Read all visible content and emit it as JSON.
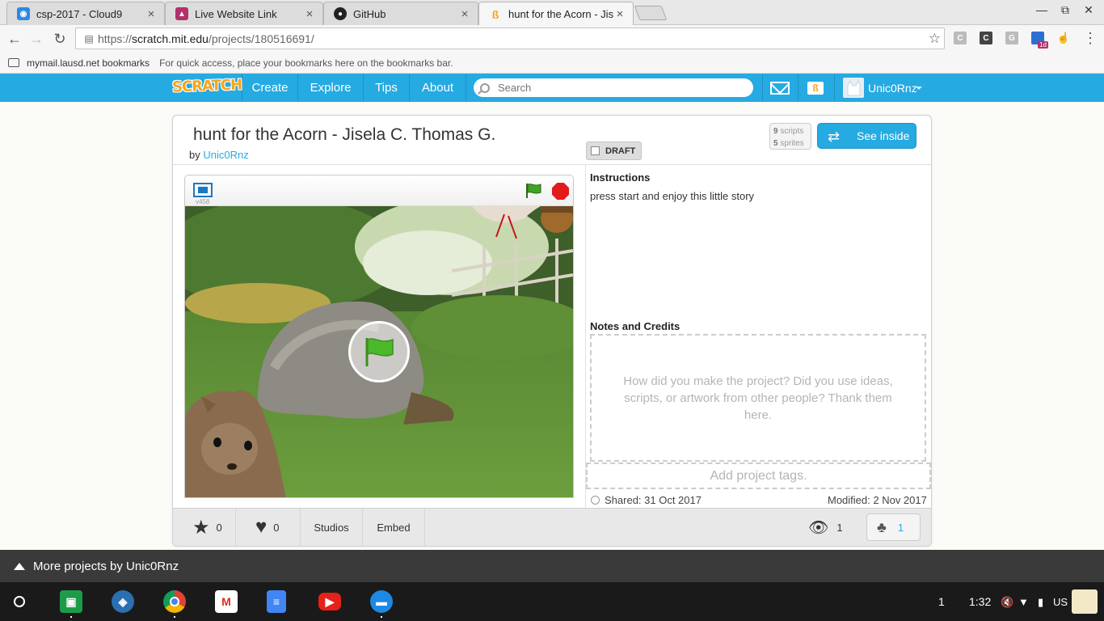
{
  "browser": {
    "tabs": [
      {
        "title": "csp-2017 - Cloud9",
        "icon": "cloud9-icon",
        "color": "#2d88e6"
      },
      {
        "title": "Live Website Link",
        "icon": "site-icon",
        "color": "#b3306b"
      },
      {
        "title": "GitHub",
        "icon": "github-icon",
        "color": "#222222"
      },
      {
        "title": "hunt for the Acorn - Jisela",
        "icon": "scratch-icon",
        "color": "#f9a41a"
      }
    ],
    "url_prefix": "https://",
    "url_host": "scratch.mit.edu",
    "url_path": "/projects/180516691/",
    "extension_badge": "1d"
  },
  "bookmarks": {
    "folder": "mymail.lausd.net bookmarks",
    "hint": "For quick access, place your bookmarks here on the bookmarks bar."
  },
  "scratch_nav": {
    "logo": "SCRATCH",
    "items": [
      "Create",
      "Explore",
      "Tips",
      "About"
    ],
    "search_placeholder": "Search",
    "username": "Unic0Rnz"
  },
  "project": {
    "title": "hunt for the Acorn - Jisela C. Thomas G.",
    "by_label": "by",
    "author": "Unic0Rnz",
    "draft_label": "DRAFT",
    "scripts_count": "9",
    "scripts_label": "scripts",
    "sprites_count": "5",
    "sprites_label": "sprites",
    "see_inside": "See inside",
    "version": "v458",
    "instructions_heading": "Instructions",
    "instructions_text": "press start and enjoy this little story",
    "notes_heading": "Notes and Credits",
    "notes_placeholder": "How did you make the project? Did you use ideas, scripts, or artwork from other people? Thank them here.",
    "tags_placeholder": "Add project tags.",
    "shared": "Shared: 31 Oct 2017",
    "modified": "Modified: 2 Nov 2017",
    "love_count": "0",
    "fav_count": "0",
    "studios_label": "Studios",
    "embed_label": "Embed",
    "views_count": "1",
    "remix_count": "1"
  },
  "more_projects": "More projects by Unic0Rnz",
  "taskbar": {
    "notif_count": "1",
    "time": "1:32",
    "locale": "US"
  }
}
